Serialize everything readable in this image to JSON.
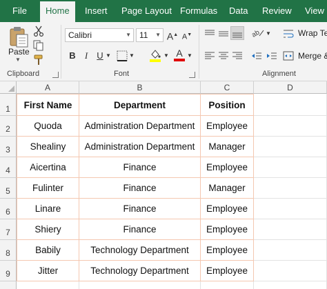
{
  "ribbon_tabs": [
    {
      "label": "File"
    },
    {
      "label": "Home",
      "active": true
    },
    {
      "label": "Insert"
    },
    {
      "label": "Page Layout"
    },
    {
      "label": "Formulas"
    },
    {
      "label": "Data"
    },
    {
      "label": "Review"
    },
    {
      "label": "View"
    }
  ],
  "clipboard": {
    "paste_label": "Paste",
    "group_label": "Clipboard"
  },
  "font": {
    "name": "Calibri",
    "size": "11",
    "group_label": "Font",
    "bold": "B",
    "italic": "I",
    "underline": "U",
    "grow": "A",
    "shrink": "A",
    "font_color_letter": "A"
  },
  "alignment": {
    "wrap_text_label": "Wrap Te",
    "merge_label": "Merge &",
    "group_label": "Alignment"
  },
  "colors": {
    "ribbon_green": "#217346",
    "fill_yellow": "#ffff00",
    "font_red": "#e00000",
    "table_border": "#f4c7b0"
  },
  "columns": [
    "A",
    "B",
    "C",
    "D"
  ],
  "rows": [
    "1",
    "2",
    "3",
    "4",
    "5",
    "6",
    "7",
    "8",
    "9"
  ],
  "table": {
    "headers": [
      "First Name",
      "Department",
      "Position"
    ],
    "rows": [
      [
        "Quoda",
        "Administration Department",
        "Employee"
      ],
      [
        "Shealiny",
        "Administration Department",
        "Manager"
      ],
      [
        "Aicertina",
        "Finance",
        "Employee"
      ],
      [
        "Fulinter",
        "Finance",
        "Manager"
      ],
      [
        "Linare",
        "Finance",
        "Employee"
      ],
      [
        "Shiery",
        "Finance",
        "Employee"
      ],
      [
        "Babily",
        "Technology Department",
        "Employee"
      ],
      [
        "Jitter",
        "Technology Department",
        "Employee"
      ]
    ]
  }
}
